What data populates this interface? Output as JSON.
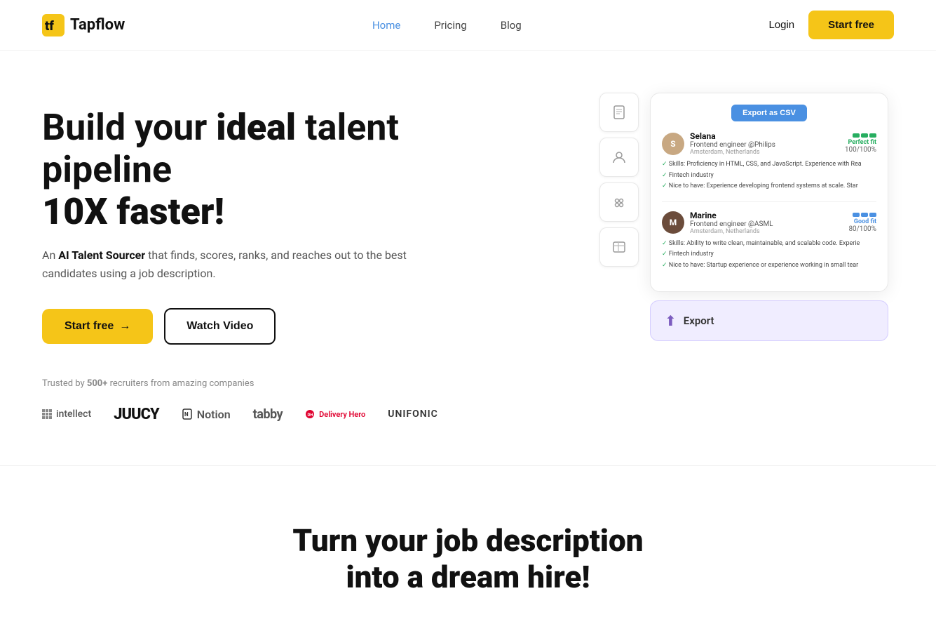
{
  "nav": {
    "logo_text": "Tapflow",
    "links": [
      {
        "label": "Home",
        "active": true
      },
      {
        "label": "Pricing",
        "active": false
      },
      {
        "label": "Blog",
        "active": false
      }
    ],
    "login_label": "Login",
    "start_free_label": "Start free"
  },
  "hero": {
    "title_line1": "Build your ",
    "title_bold": "ideal",
    "title_rest": " talent pipeline",
    "title_line2": "10X faster!",
    "subtitle_prefix": "An ",
    "subtitle_bold": "AI Talent Sourcer",
    "subtitle_main": " that finds, scores, ranks, and reaches out to the best candidates using a job description.",
    "btn_start": "Start free",
    "btn_start_arrow": "→",
    "btn_watch": "Watch Video",
    "trusted_prefix": "Trusted by ",
    "trusted_count": "500+",
    "trusted_suffix": " recruiters from amazing companies",
    "companies": [
      {
        "name": "intellect",
        "type": "grid"
      },
      {
        "name": "JUUCY",
        "type": "juucy"
      },
      {
        "name": "Notion",
        "type": "notion"
      },
      {
        "name": "tabby",
        "type": "tabby"
      },
      {
        "name": "Delivery Hero",
        "type": "delivery"
      },
      {
        "name": "UNIFONIC",
        "type": "unifonic"
      }
    ]
  },
  "mockup": {
    "export_csv_label": "Export as CSV",
    "candidates": [
      {
        "name": "Selana",
        "role": "Frontend engineer @Philips",
        "location": "Amsterdam, Netherlands",
        "fit_label": "Perfect fit",
        "score": "100/100%",
        "fit_type": "perfect",
        "bars": 3,
        "skills": [
          "Skills: Proficiency in HTML, CSS, and JavaScript. Experience with Rea",
          "Fintech industry",
          "Nice to have: Experience developing frontend systems at scale. Star"
        ]
      },
      {
        "name": "Marine",
        "role": "Frontend engineer @ASML",
        "location": "Amsterdam, Netherlands",
        "fit_label": "Good fit",
        "score": "80/100%",
        "fit_type": "good",
        "bars": 3,
        "skills": [
          "Skills: Ability to write clean, maintainable, and scalable code. Experie",
          "Fintech industry",
          "Nice to have: Startup experience or experience working in small tear"
        ]
      }
    ],
    "export_label": "Export"
  },
  "bottom": {
    "line1": "Turn your job description",
    "line2": "into a dream hire!"
  }
}
